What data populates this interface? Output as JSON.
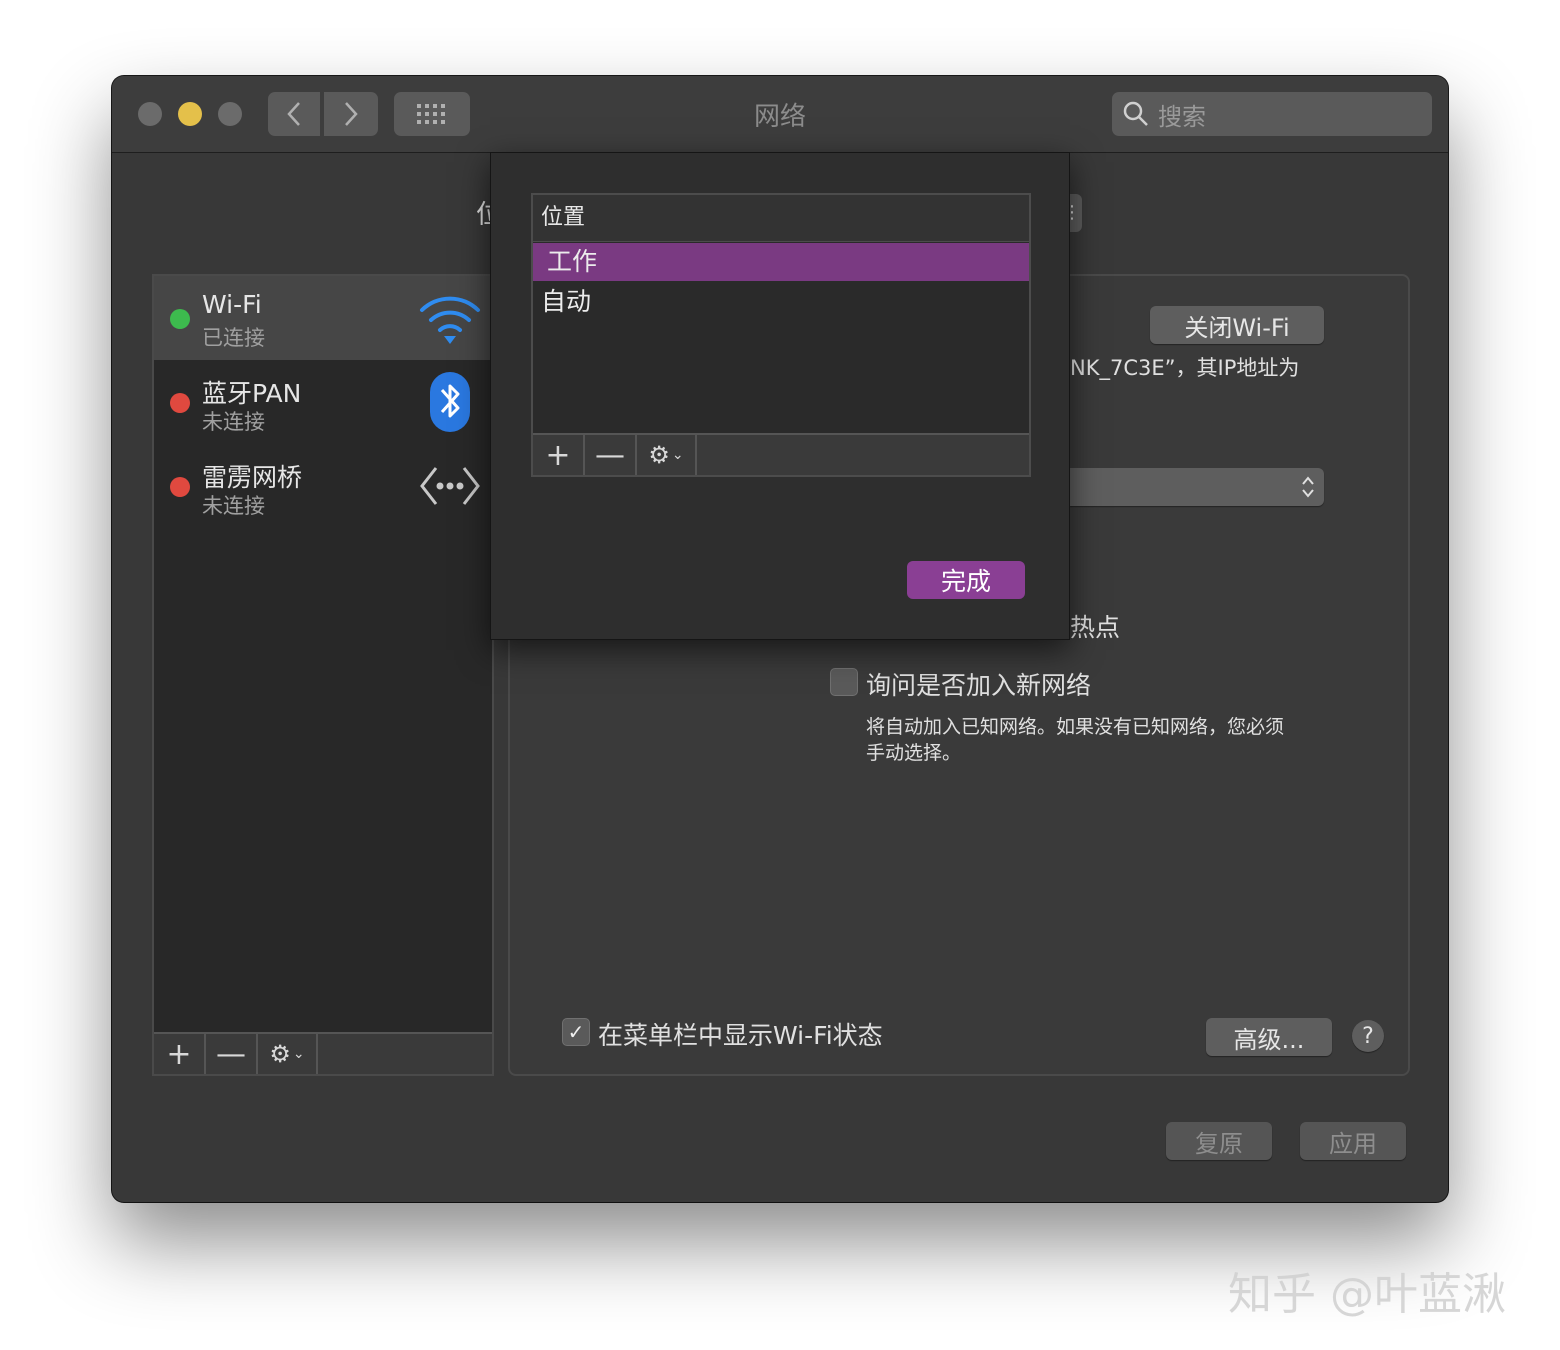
{
  "window": {
    "title": "网络",
    "search_placeholder": "搜索",
    "traffic_light_colors": [
      "#6b6b6b",
      "#e4c04a",
      "#6b6b6b"
    ],
    "accent_color": "#8a3f94"
  },
  "location": {
    "label_partial": "位"
  },
  "sidebar": {
    "services": [
      {
        "name": "Wi-Fi",
        "status": "已连接",
        "status_color": "#3dbb4e",
        "icon": "wifi-icon"
      },
      {
        "name": "蓝牙PAN",
        "status": "未连接",
        "status_color": "#e0493f",
        "icon": "bluetooth-icon"
      },
      {
        "name": "雷雳网桥",
        "status": "未连接",
        "status_color": "#e0493f",
        "icon": "thunderbolt-bridge-icon"
      }
    ],
    "toolbar": {
      "add": "+",
      "remove": "—",
      "gear": "⚙"
    }
  },
  "detail": {
    "turn_off_wifi": "关闭Wi-Fi",
    "status_text_partial": "NK_7C3E”，其IP地址为",
    "hotspot_partial": "热点",
    "ask_join_label": "询问是否加入新网络",
    "ask_join_desc_line1": "将自动加入已知网络。如果没有已知网络，您必须",
    "ask_join_desc_line2": "手动选择。",
    "show_in_menubar_label": "在菜单栏中显示Wi-Fi状态",
    "advanced": "高级...",
    "help": "?"
  },
  "footer": {
    "revert": "复原",
    "apply": "应用"
  },
  "popup": {
    "list_header": "位置",
    "locations": [
      "工作",
      "自动"
    ],
    "selected_index": 0,
    "toolbar": {
      "add": "+",
      "remove": "—",
      "gear": "⚙"
    },
    "done": "完成"
  },
  "watermark": "知乎 @叶蓝湫"
}
